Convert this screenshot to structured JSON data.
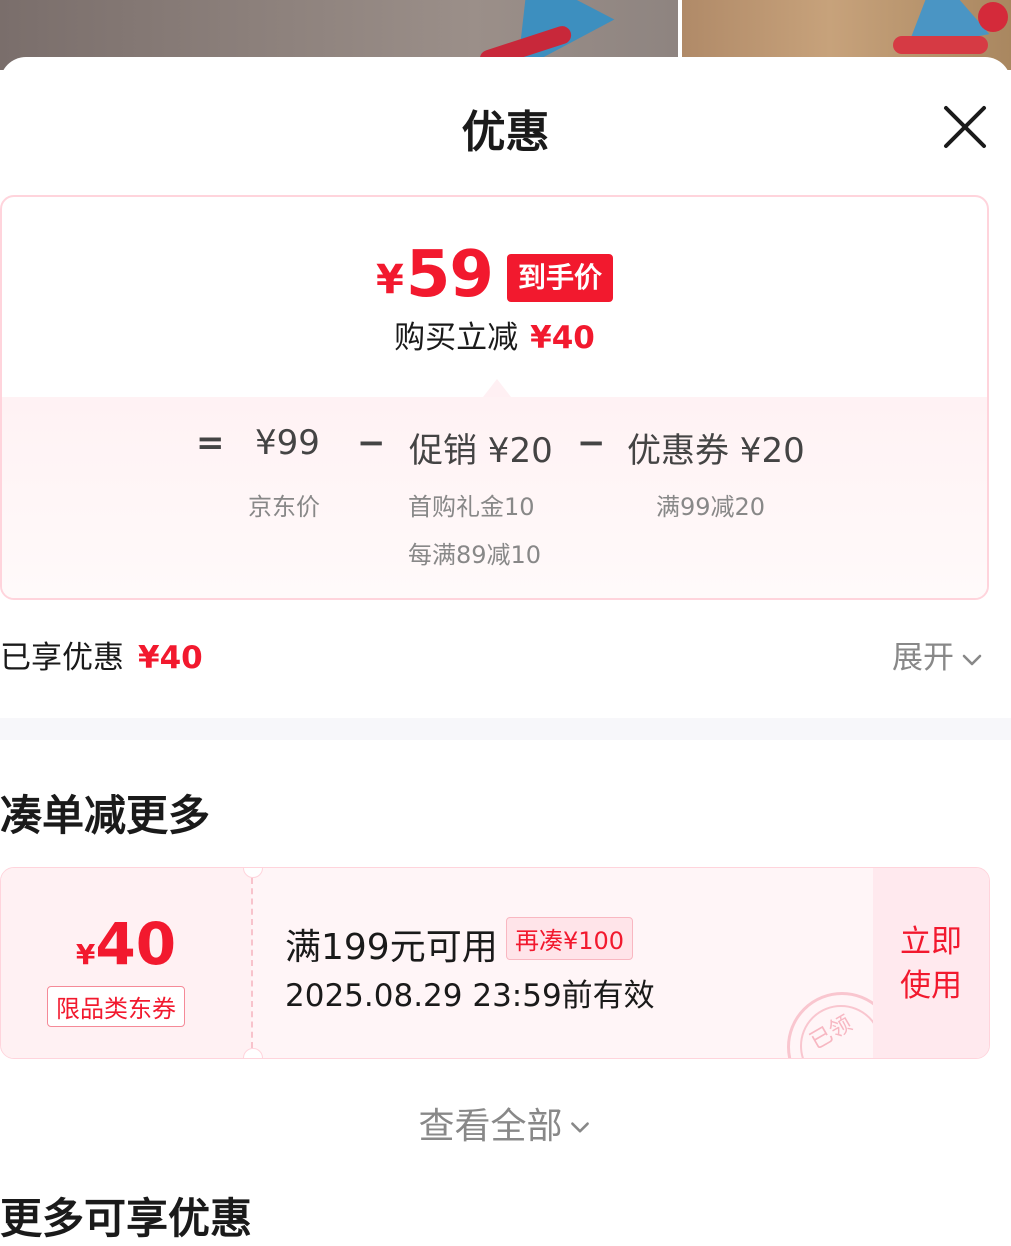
{
  "header": {
    "title": "优惠",
    "close_icon": "close-icon"
  },
  "price_card": {
    "final_currency": "¥",
    "final_amount": "59",
    "final_badge": "到手价",
    "save_label": "购买立减",
    "save_amount": "¥40",
    "formula": {
      "equals": "=",
      "jd_price": "¥99",
      "minus1": "−",
      "promo": "促销 ¥20",
      "minus2": "−",
      "coupon": "优惠券 ¥20"
    },
    "jd_price_label": "京东价",
    "promo_details": [
      "首购礼金10",
      "每满89减10"
    ],
    "coupon_detail": "满99减20"
  },
  "enjoyed": {
    "label": "已享优惠",
    "amount": "¥40",
    "expand_label": "展开"
  },
  "bundle_section": {
    "title": "凑单减更多",
    "coupon": {
      "currency": "¥",
      "amount": "40",
      "tag": "限品类东券",
      "condition": "满199元可用",
      "more_needed": "再凑¥100",
      "valid_until": "2025.08.29 23:59前有效",
      "use_label_line1": "立即",
      "use_label_line2": "使用",
      "stamp_text": "已领"
    },
    "view_all": "查看全部"
  },
  "more_section": {
    "title": "更多可享优惠"
  },
  "colors": {
    "accent": "#f2192e",
    "card_border": "#ffd4dc",
    "muted": "#888888"
  }
}
